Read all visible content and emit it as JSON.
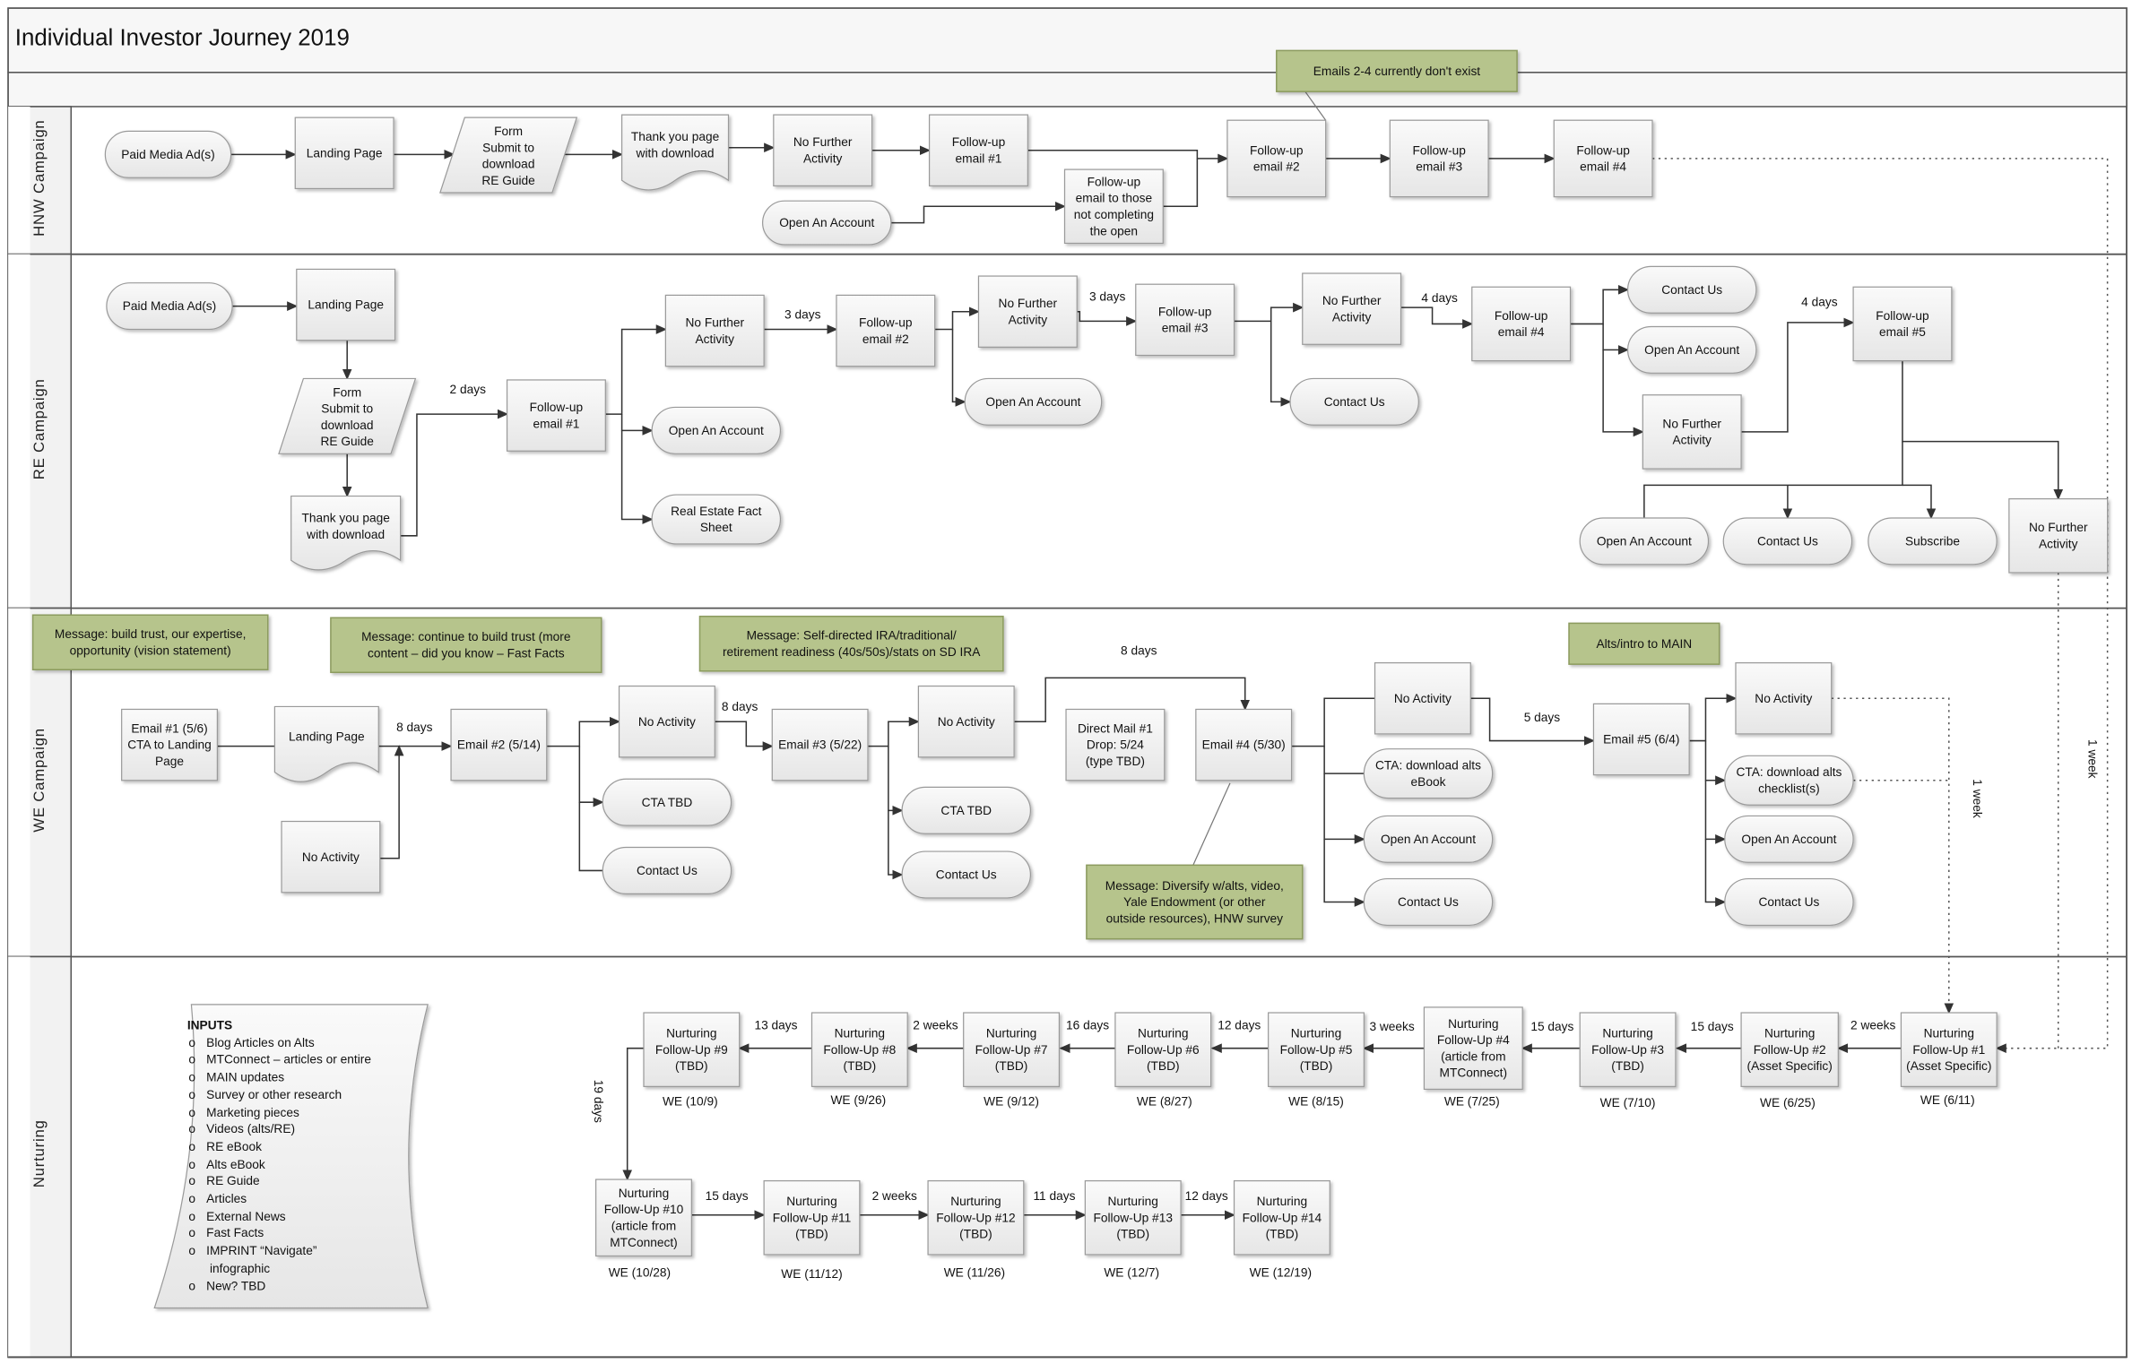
{
  "title": "Individual Investor Journey 2019",
  "lanes": {
    "hnw": "HNW Campaign",
    "re": "RE Campaign",
    "we": "WE Campaign",
    "nurturing": "Nurturing"
  },
  "colors": {
    "note_fill": "#b6c48c",
    "note_border": "#8c9b5e",
    "box_fill": "#efefef",
    "box_border": "#9a9a9a",
    "line": "#333333",
    "lane_border": "#555555"
  },
  "notes": {
    "emails_note": "Emails 2-4 currently don't exist",
    "we_msg1": "Message: build trust, our expertise,\nopportunity (vision statement)",
    "we_msg2": "Message: continue to build trust (more\ncontent – did you know – Fast Facts",
    "we_msg3": "Message: Self-directed IRA/traditional/\nretirement readiness (40s/50s)/stats on SD IRA",
    "we_msg4": "Alts/intro to MAIN",
    "we_msg5": "Message: Diversify w/alts, video,\nYale Endowment (or other\noutside resources), HNW survey"
  },
  "nodes": {
    "hnw_paid": {
      "label": "Paid Media Ad(s)",
      "shape": "terminator"
    },
    "hnw_landing": {
      "label": "Landing Page",
      "shape": "rect"
    },
    "hnw_form": {
      "label": "Form\nSubmit to\ndownload\nRE Guide",
      "shape": "parallelogram"
    },
    "hnw_thanks": {
      "label": "Thank you page\nwith download",
      "shape": "document"
    },
    "hnw_nofurther": {
      "label": "No Further\nActivity",
      "shape": "rect"
    },
    "hnw_fu1": {
      "label": "Follow-up\nemail #1",
      "shape": "rect"
    },
    "hnw_open": {
      "label": "Open An Account",
      "shape": "terminator"
    },
    "hnw_fu_those": {
      "label": "Follow-up\nemail to those\nnot completing\nthe open",
      "shape": "rect"
    },
    "hnw_fu2": {
      "label": "Follow-up\nemail #2",
      "shape": "rect"
    },
    "hnw_fu3": {
      "label": "Follow-up\nemail #3",
      "shape": "rect"
    },
    "hnw_fu4": {
      "label": "Follow-up\nemail #4",
      "shape": "rect"
    },
    "re_paid": {
      "label": "Paid Media Ad(s)",
      "shape": "terminator"
    },
    "re_landing": {
      "label": "Landing Page",
      "shape": "rect"
    },
    "re_form": {
      "label": "Form\nSubmit to\ndownload\nRE Guide",
      "shape": "parallelogram"
    },
    "re_thanks": {
      "label": "Thank you page\nwith download",
      "shape": "document"
    },
    "re_fu1": {
      "label": "Follow-up\nemail #1",
      "shape": "rect"
    },
    "re_nofurther1": {
      "label": "No Further\nActivity",
      "shape": "rect"
    },
    "re_open1": {
      "label": "Open An Account",
      "shape": "terminator"
    },
    "re_fact": {
      "label": "Real Estate Fact\nSheet",
      "shape": "terminator"
    },
    "re_fu2": {
      "label": "Follow-up\nemail #2",
      "shape": "rect"
    },
    "re_nofurther2": {
      "label": "No Further\nActivity",
      "shape": "rect"
    },
    "re_open2": {
      "label": "Open An Account",
      "shape": "terminator"
    },
    "re_fu3": {
      "label": "Follow-up\nemail #3",
      "shape": "rect"
    },
    "re_nofurther3": {
      "label": "No Further\nActivity",
      "shape": "rect"
    },
    "re_contact1": {
      "label": "Contact Us",
      "shape": "terminator"
    },
    "re_fu4": {
      "label": "Follow-up\nemail #4",
      "shape": "rect"
    },
    "re_contact2": {
      "label": "Contact Us",
      "shape": "terminator"
    },
    "re_open3": {
      "label": "Open An Account",
      "shape": "terminator"
    },
    "re_nofurther4": {
      "label": "No Further\nActivity",
      "shape": "rect"
    },
    "re_fu5": {
      "label": "Follow-up\nemail #5",
      "shape": "rect"
    },
    "re_open4": {
      "label": "Open An Account",
      "shape": "terminator"
    },
    "re_contact3": {
      "label": "Contact Us",
      "shape": "terminator"
    },
    "re_subscribe": {
      "label": "Subscribe",
      "shape": "terminator"
    },
    "re_nofurther5": {
      "label": "No Further\nActivity",
      "shape": "rect"
    },
    "we_email1": {
      "label": "Email #1 (5/6)\nCTA to Landing\nPage",
      "shape": "rect"
    },
    "we_landing": {
      "label": "Landing Page",
      "shape": "document"
    },
    "we_noact1": {
      "label": "No Activity",
      "shape": "rect"
    },
    "we_email2": {
      "label": "Email #2 (5/14)",
      "shape": "rect"
    },
    "we_noact2": {
      "label": "No Activity",
      "shape": "rect"
    },
    "we_cta1": {
      "label": "CTA TBD",
      "shape": "terminator"
    },
    "we_contact1": {
      "label": "Contact Us",
      "shape": "terminator"
    },
    "we_email3": {
      "label": "Email #3 (5/22)",
      "shape": "rect"
    },
    "we_noact3": {
      "label": "No Activity",
      "shape": "rect"
    },
    "we_cta2": {
      "label": "CTA TBD",
      "shape": "terminator"
    },
    "we_contact2": {
      "label": "Contact Us",
      "shape": "terminator"
    },
    "we_dm": {
      "label": "Direct Mail #1\nDrop: 5/24\n(type TBD)",
      "shape": "rect"
    },
    "we_email4": {
      "label": "Email #4 (5/30)",
      "shape": "rect"
    },
    "we_noact4": {
      "label": "No Activity",
      "shape": "rect"
    },
    "we_ctaalts": {
      "label": "CTA: download alts\neBook",
      "shape": "terminator"
    },
    "we_open1": {
      "label": "Open An Account",
      "shape": "terminator"
    },
    "we_contact3": {
      "label": "Contact Us",
      "shape": "terminator"
    },
    "we_email5": {
      "label": "Email #5 (6/4)",
      "shape": "rect"
    },
    "we_noact5": {
      "label": "No Activity",
      "shape": "rect"
    },
    "we_ctachk": {
      "label": "CTA: download alts\nchecklist(s)",
      "shape": "terminator"
    },
    "we_open2": {
      "label": "Open An Account",
      "shape": "terminator"
    },
    "we_contact4": {
      "label": "Contact Us",
      "shape": "terminator"
    },
    "n1": {
      "label": "Nurturing\nFollow-Up #1\n(Asset Specific)",
      "shape": "rect"
    },
    "n2": {
      "label": "Nurturing\nFollow-Up #2\n(Asset Specific)",
      "shape": "rect"
    },
    "n3": {
      "label": "Nurturing\nFollow-Up #3\n(TBD)",
      "shape": "rect"
    },
    "n4": {
      "label": "Nurturing\nFollow-Up #4\n(article from\nMTConnect)",
      "shape": "rect"
    },
    "n5": {
      "label": "Nurturing\nFollow-Up #5\n(TBD)",
      "shape": "rect"
    },
    "n6": {
      "label": "Nurturing\nFollow-Up #6\n(TBD)",
      "shape": "rect"
    },
    "n7": {
      "label": "Nurturing\nFollow-Up #7\n(TBD)",
      "shape": "rect"
    },
    "n8": {
      "label": "Nurturing\nFollow-Up #8\n(TBD)",
      "shape": "rect"
    },
    "n9": {
      "label": "Nurturing\nFollow-Up #9\n(TBD)",
      "shape": "rect"
    },
    "n10": {
      "label": "Nurturing\nFollow-Up #10\n(article from\nMTConnect)",
      "shape": "rect"
    },
    "n11": {
      "label": "Nurturing\nFollow-Up #11\n(TBD)",
      "shape": "rect"
    },
    "n12": {
      "label": "Nurturing\nFollow-Up #12\n(TBD)",
      "shape": "rect"
    },
    "n13": {
      "label": "Nurturing\nFollow-Up #13\n(TBD)",
      "shape": "rect"
    },
    "n14": {
      "label": "Nurturing\nFollow-Up #14\n(TBD)",
      "shape": "rect"
    }
  },
  "edge_labels": {
    "re_2days": "2 days",
    "re_3days_a": "3 days",
    "re_3days_b": "3 days",
    "re_4days_a": "4 days",
    "re_4days_b": "4 days",
    "we_8days_a": "8 days",
    "we_8days_b": "8 days",
    "we_8days_c": "8 days",
    "we_5days": "5 days",
    "n_13days": "13 days",
    "n_2weeks_a": "2 weeks",
    "n_16days": "16 days",
    "n_12days_a": "12 days",
    "n_3weeks": "3 weeks",
    "n_15days_a": "15 days",
    "n_15days_b": "15 days",
    "n_2weeks_b": "2 weeks",
    "n_15days_c": "15 days",
    "n_2weeks_c": "2 weeks",
    "n_11days": "11 days",
    "n_12days_b": "12 days"
  },
  "vertical_labels": {
    "n_19days": "19 days",
    "we_1week": "1 week",
    "re_1week": "1 week"
  },
  "dates": {
    "d1": "WE (6/11)",
    "d2": "WE (6/25)",
    "d3": "WE (7/10)",
    "d4": "WE (7/25)",
    "d5": "WE (8/15)",
    "d6": "WE (8/27)",
    "d7": "WE (9/12)",
    "d8": "WE (9/26)",
    "d9": "WE (10/9)",
    "d10": "WE (10/28)",
    "d11": "WE (11/12)",
    "d12": "WE (11/26)",
    "d13": "WE (12/7)",
    "d14": "WE (12/19)"
  },
  "inputs": {
    "heading": "INPUTS",
    "items": [
      "Blog Articles on Alts",
      "MTConnect – articles or entire",
      "MAIN updates",
      "Survey or other research",
      "Marketing pieces",
      "Videos (alts/RE)",
      "RE eBook",
      "Alts eBook",
      "RE Guide",
      "Articles",
      "External News",
      "Fast Facts",
      "IMPRINT “Navigate”\n infographic",
      "New? TBD"
    ]
  }
}
